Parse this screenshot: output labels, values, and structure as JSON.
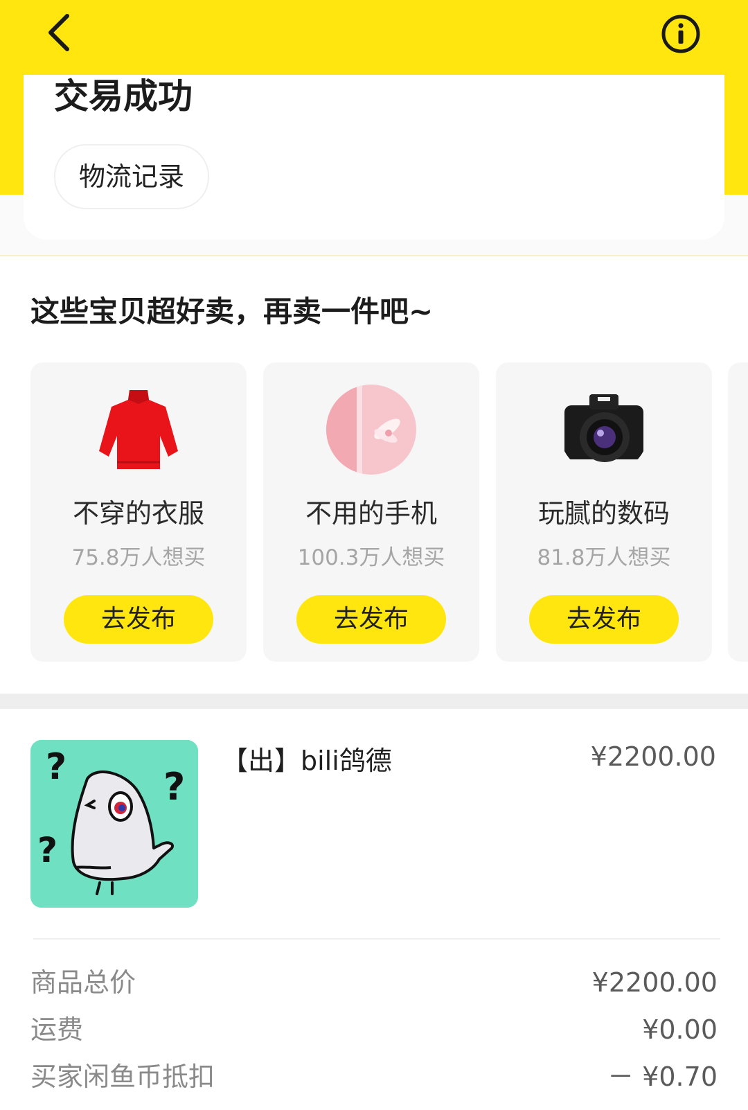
{
  "colors": {
    "accent": "#ffe60f",
    "card_bg": "#f6f6f6",
    "thumb_bg": "#6fe0c2"
  },
  "header": {
    "back_icon": "chevron-left-icon",
    "info_icon": "info-circle-icon"
  },
  "status": {
    "title": "交易成功",
    "logistics_button": "物流记录"
  },
  "recommend": {
    "title": "这些宝贝超好卖，再卖一件吧~",
    "cards": [
      {
        "title": "不穿的衣服",
        "count": "75.8万人想买",
        "button": "去发布",
        "image": "red-sweater"
      },
      {
        "title": "不用的手机",
        "count": "100.3万人想买",
        "button": "去发布",
        "image": "pink-phone"
      },
      {
        "title": "玩腻的数码",
        "count": "81.8万人想买",
        "button": "去发布",
        "image": "camera"
      }
    ]
  },
  "product": {
    "title": "【出】bili鸽德",
    "price": "¥2200.00",
    "image": "confused-pigeon"
  },
  "fees": [
    {
      "label": "商品总价",
      "value": "¥2200.00"
    },
    {
      "label": "运费",
      "value": "¥0.00"
    },
    {
      "label": "买家闲鱼币抵扣",
      "value": "－ ¥0.70"
    }
  ]
}
